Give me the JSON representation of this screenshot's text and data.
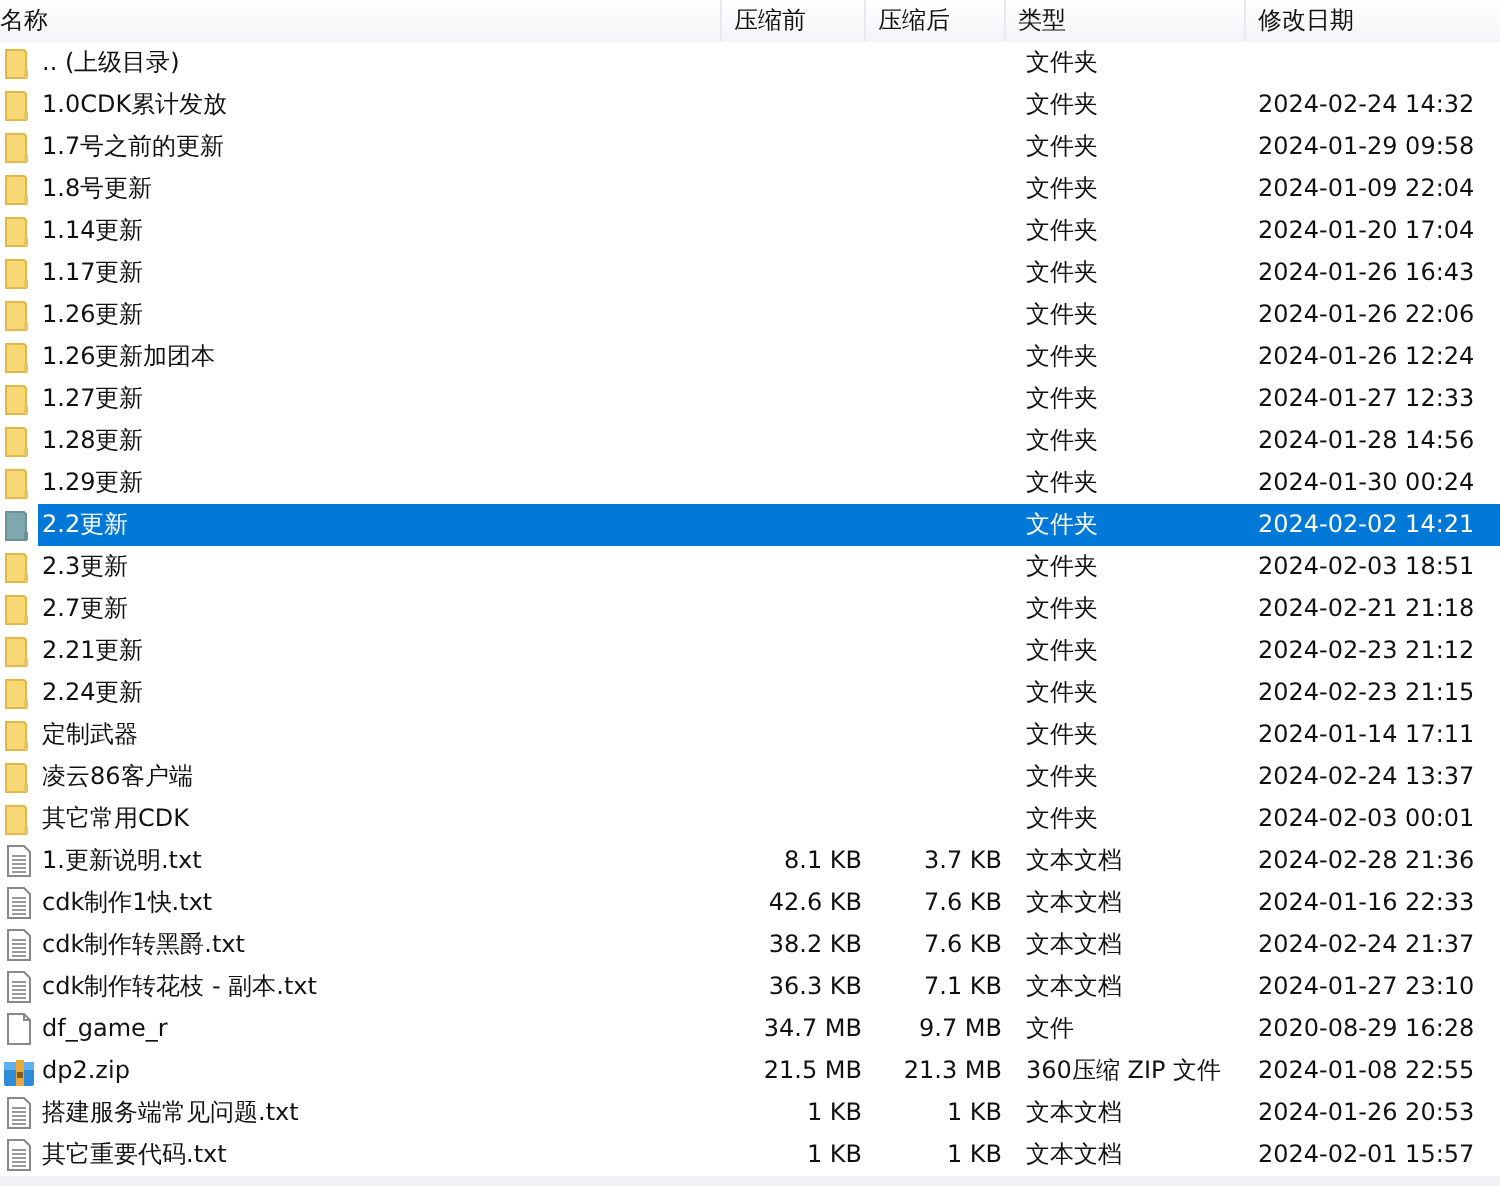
{
  "columns": [
    "名称",
    "压缩前",
    "压缩后",
    "类型",
    "修改日期"
  ],
  "rows": [
    {
      "kind": "folder",
      "name": ".. (上级目录)",
      "before": "",
      "after": "",
      "type": "文件夹",
      "date": "",
      "selected": false
    },
    {
      "kind": "folder",
      "name": "1.0CDK累计发放",
      "type": "文件夹",
      "date": "2024-02-24 14:32",
      "selected": false
    },
    {
      "kind": "folder",
      "name": "1.7号之前的更新",
      "type": "文件夹",
      "date": "2024-01-29 09:58",
      "selected": false
    },
    {
      "kind": "folder",
      "name": "1.8号更新",
      "type": "文件夹",
      "date": "2024-01-09 22:04",
      "selected": false
    },
    {
      "kind": "folder",
      "name": "1.14更新",
      "type": "文件夹",
      "date": "2024-01-20 17:04",
      "selected": false
    },
    {
      "kind": "folder",
      "name": "1.17更新",
      "type": "文件夹",
      "date": "2024-01-26 16:43",
      "selected": false
    },
    {
      "kind": "folder",
      "name": "1.26更新",
      "type": "文件夹",
      "date": "2024-01-26 22:06",
      "selected": false
    },
    {
      "kind": "folder",
      "name": "1.26更新加团本",
      "type": "文件夹",
      "date": "2024-01-26 12:24",
      "selected": false
    },
    {
      "kind": "folder",
      "name": "1.27更新",
      "type": "文件夹",
      "date": "2024-01-27 12:33",
      "selected": false
    },
    {
      "kind": "folder",
      "name": "1.28更新",
      "type": "文件夹",
      "date": "2024-01-28 14:56",
      "selected": false
    },
    {
      "kind": "folder",
      "name": "1.29更新",
      "type": "文件夹",
      "date": "2024-01-30 00:24",
      "selected": false
    },
    {
      "kind": "folder",
      "name": "2.2更新",
      "type": "文件夹",
      "date": "2024-02-02 14:21",
      "selected": true
    },
    {
      "kind": "folder",
      "name": "2.3更新",
      "type": "文件夹",
      "date": "2024-02-03 18:51",
      "selected": false
    },
    {
      "kind": "folder",
      "name": "2.7更新",
      "type": "文件夹",
      "date": "2024-02-21 21:18",
      "selected": false
    },
    {
      "kind": "folder",
      "name": "2.21更新",
      "type": "文件夹",
      "date": "2024-02-23 21:12",
      "selected": false
    },
    {
      "kind": "folder",
      "name": "2.24更新",
      "type": "文件夹",
      "date": "2024-02-23 21:15",
      "selected": false
    },
    {
      "kind": "folder",
      "name": "定制武器",
      "type": "文件夹",
      "date": "2024-01-14 17:11",
      "selected": false
    },
    {
      "kind": "folder",
      "name": "凌云86客户端",
      "type": "文件夹",
      "date": "2024-02-24 13:37",
      "selected": false
    },
    {
      "kind": "folder",
      "name": "其它常用CDK",
      "type": "文件夹",
      "date": "2024-02-03 00:01",
      "selected": false
    },
    {
      "kind": "text",
      "name": "1.更新说明.txt",
      "before": "8.1 KB",
      "after": "3.7 KB",
      "type": "文本文档",
      "date": "2024-02-28 21:36",
      "selected": false
    },
    {
      "kind": "text",
      "name": "cdk制作1快.txt",
      "before": "42.6 KB",
      "after": "7.6 KB",
      "type": "文本文档",
      "date": "2024-01-16 22:33",
      "selected": false
    },
    {
      "kind": "text",
      "name": "cdk制作转黑爵.txt",
      "before": "38.2 KB",
      "after": "7.6 KB",
      "type": "文本文档",
      "date": "2024-02-24 21:37",
      "selected": false
    },
    {
      "kind": "text",
      "name": "cdk制作转花枝 - 副本.txt",
      "before": "36.3 KB",
      "after": "7.1 KB",
      "type": "文本文档",
      "date": "2024-01-27 23:10",
      "selected": false
    },
    {
      "kind": "file",
      "name": "df_game_r",
      "before": "34.7 MB",
      "after": "9.7 MB",
      "type": "文件",
      "date": "2020-08-29 16:28",
      "selected": false
    },
    {
      "kind": "zip",
      "name": "dp2.zip",
      "before": "21.5 MB",
      "after": "21.3 MB",
      "type": "360压缩 ZIP 文件",
      "date": "2024-01-08 22:55",
      "selected": false
    },
    {
      "kind": "text",
      "name": "搭建服务端常见问题.txt",
      "before": "1 KB",
      "after": "1 KB",
      "type": "文本文档",
      "date": "2024-01-26 20:53",
      "selected": false
    },
    {
      "kind": "text",
      "name": "其它重要代码.txt",
      "before": "1 KB",
      "after": "1 KB",
      "type": "文本文档",
      "date": "2024-02-01 15:57",
      "selected": false
    }
  ]
}
